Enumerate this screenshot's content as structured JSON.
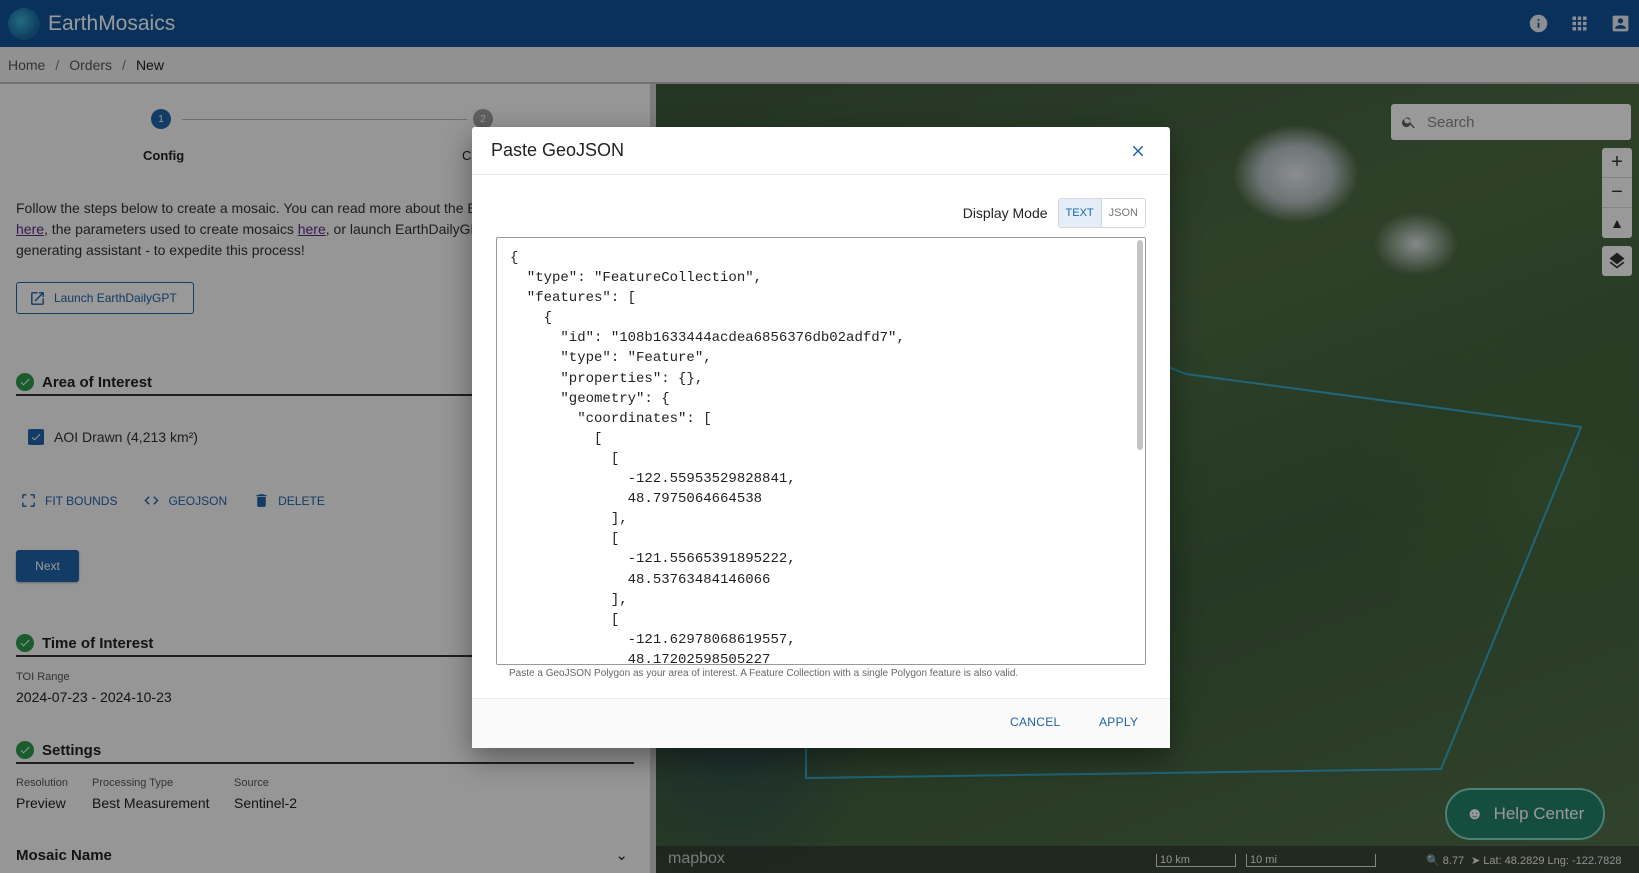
{
  "app": {
    "title": "EarthMosaics"
  },
  "breadcrumb": {
    "items": [
      "Home",
      "Orders",
      "New"
    ]
  },
  "stepper": {
    "steps": [
      {
        "number": "1",
        "label": "Config"
      },
      {
        "number": "2",
        "label": "C"
      }
    ]
  },
  "intro": {
    "line1": "Follow the steps below to create a mosaic. You can read more about the E",
    "link1": "here",
    "mid1": ", the parameters used to create mosaics ",
    "link2": "here",
    "mid2": ", or launch EarthDailyGP",
    "line3": "generating assistant - to expedite this process!"
  },
  "launch_button": {
    "label": "Launch EarthDailyGPT"
  },
  "aoi_section": {
    "title": "Area of Interest",
    "item_label": "AOI Drawn (4,213 km²)",
    "checked": true,
    "actions": [
      "FIT BOUNDS",
      "GEOJSON",
      "DELETE"
    ],
    "next_label": "Next"
  },
  "toi_section": {
    "title": "Time of Interest",
    "range_label": "TOI Range",
    "range_value": "2024-07-23 - 2024-10-23"
  },
  "settings_section": {
    "title": "Settings",
    "fields": [
      {
        "label": "Resolution",
        "value": "Preview"
      },
      {
        "label": "Processing Type",
        "value": "Best Measurement"
      },
      {
        "label": "Source",
        "value": "Sentinel-2"
      }
    ]
  },
  "mosaic_name_section": {
    "title": "Mosaic Name"
  },
  "map": {
    "search_placeholder": "Search",
    "help_center_label": "Help Center",
    "attribution": "mapbox",
    "scale_km": "10 km",
    "scale_mi": "10 mi",
    "zoom_level": "8.77",
    "coords": "Lat: 48.2829 Lng: -122.7828"
  },
  "modal": {
    "title": "Paste GeoJSON",
    "display_mode_label": "Display Mode",
    "modes": [
      "TEXT",
      "JSON"
    ],
    "active_mode": "TEXT",
    "json_text": "{\n  \"type\": \"FeatureCollection\",\n  \"features\": [\n    {\n      \"id\": \"108b1633444acdea6856376db02adfd7\",\n      \"type\": \"Feature\",\n      \"properties\": {},\n      \"geometry\": {\n        \"coordinates\": [\n          [\n            [\n              -122.55953529828841,\n              48.7975064664538\n            ],\n            [\n              -121.55665391895222,\n              48.53763484146066\n            ],\n            [\n              -121.62978068619557,\n              48.17202598505227",
    "helper_text": "Paste a GeoJSON Polygon as your area of interest. A Feature Collection with a single Polygon feature is also valid.",
    "cancel_label": "CANCEL",
    "apply_label": "APPLY"
  },
  "colors": {
    "primary": "#1f63a8",
    "topbar": "#0f5398",
    "success": "#2e9a4a",
    "help_center": "#24806a"
  }
}
